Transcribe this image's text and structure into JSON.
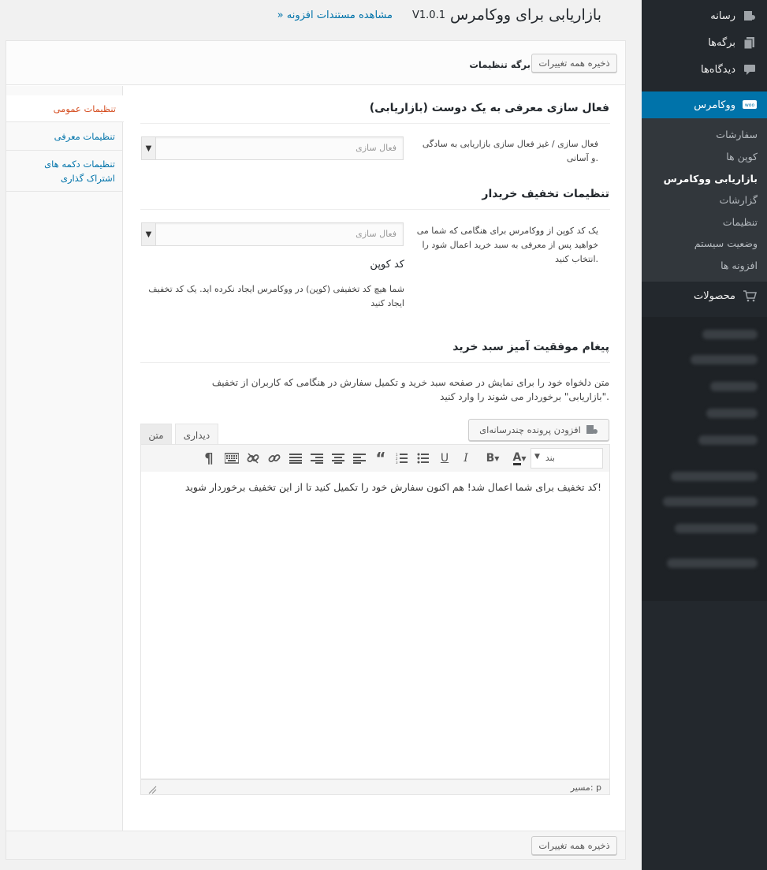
{
  "header": {
    "title": "بازاریابی برای ووکامرس",
    "version": "V1.0.1",
    "docs_link": "» مشاهده مستندات افزونه"
  },
  "admin_menu": {
    "items": [
      {
        "label": "رسانه",
        "icon": "media-icon"
      },
      {
        "label": "برگه‌ها",
        "icon": "pages-icon"
      },
      {
        "label": "دیدگاه‌ها",
        "icon": "comments-icon"
      },
      {
        "label": "ووکامرس",
        "icon": "woo-icon"
      },
      {
        "label": "محصولات",
        "icon": "cart-icon"
      }
    ],
    "submenu": [
      "سفارشات",
      "کوپن ها",
      "بازاریابی ووکامرس",
      "گزارشات",
      "تنظیمات",
      "وضعیت سیستم",
      "افزونه ها"
    ],
    "active_color": "#0073aa"
  },
  "panel": {
    "page_label": "برگه تنظیمات",
    "save_label": "ذخیره همه تغییرات",
    "nav": [
      "تنظیمات عمومی",
      "تنظیمات معرفی",
      "تنظیمات دکمه های اشتراک گذاری"
    ]
  },
  "sections": {
    "activate": {
      "title": "فعال سازی معرفی به یک دوست (بازاریابی)",
      "desc": "فعال سازی / غیز فعال سازی بازاریابی به سادگی و آسانی.",
      "select": "فعال سازی"
    },
    "discount": {
      "title": "تنظیمات تخفیف خریدار",
      "desc": "یک کد کوپن از ووکامرس برای هنگامی که شما می خواهید پس از معرفی به سبد خرید اعمال شود را انتخاب کنید.",
      "select": "فعال سازی",
      "coupon_label": "کد کوپن",
      "coupon_note": "شما هیچ کد تخفیفی (کوپن) در ووکامرس ایجاد نکرده اید. یک کد تخفیف ایجاد کنید"
    },
    "success": {
      "title": "پیغام موفقیت آمیز سبد خرید",
      "desc": "متن دلخواه خود را برای نمایش در صفحه سبد خرید و تکمیل سفارش در هنگامی که کاربران از تخفیف \"بازاریابی\" برخوردار می شوند را وارد کنید."
    }
  },
  "editor": {
    "add_media": "افزودن پرونده چندرسانه‌ای",
    "tab_visual": "دیداری",
    "tab_text": "متن",
    "format_select": "بند",
    "content": "کد تخفیف برای شما اعمال شد! هم اکنون سفارش خود را تکمیل کنید تا از این تخفیف برخوردار شوید!",
    "path": "مسیر: p"
  }
}
